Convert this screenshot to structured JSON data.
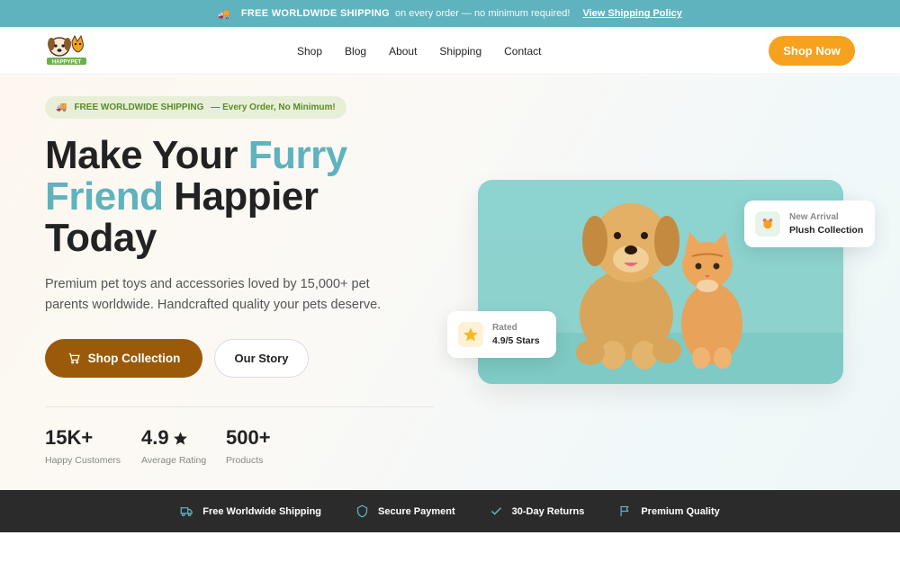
{
  "announcement": {
    "icon": "truck-icon",
    "bold": "FREE WORLDWIDE SHIPPING",
    "rest": "on every order — no minimum required!",
    "link": "View Shipping Policy"
  },
  "header": {
    "logo_text": "HAPPYPET",
    "nav": [
      "Shop",
      "Blog",
      "About",
      "Shipping",
      "Contact"
    ],
    "cta": "Shop Now"
  },
  "hero": {
    "pill": {
      "bold": "FREE WORLDWIDE SHIPPING",
      "rest": "— Every Order, No Minimum!"
    },
    "headline": {
      "part1": "Make Your ",
      "accent1": "Furry",
      "accent2": "Friend",
      "part2": " Happier",
      "part3": "Today"
    },
    "subtext": "Premium pet toys and accessories loved by 15,000+ pet parents worldwide. Handcrafted quality your pets deserve.",
    "primary_button": "Shop Collection",
    "secondary_button": "Our Story",
    "stats": [
      {
        "value": "15K+",
        "label": "Happy Customers"
      },
      {
        "value": "4.9",
        "label": "Average Rating"
      },
      {
        "value": "500+",
        "label": "Products"
      }
    ]
  },
  "cards": {
    "new_arrival": {
      "label": "New Arrival",
      "title": "Plush Collection"
    },
    "rated": {
      "label": "Rated",
      "title": "4.9/5 Stars"
    }
  },
  "features": [
    "Free Worldwide Shipping",
    "Secure Payment",
    "30-Day Returns",
    "Premium Quality"
  ],
  "colors": {
    "accent": "#5eb3be",
    "cta": "#f6a21e",
    "primary_button": "#9a5a0a",
    "dark_bar": "#2b2b2b"
  }
}
